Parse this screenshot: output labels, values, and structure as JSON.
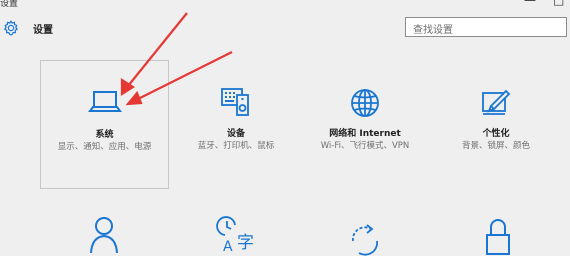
{
  "window": {
    "title": "设置",
    "minimize_glyph": "—",
    "close_glyph": "□"
  },
  "header": {
    "icon": "gear-icon",
    "title": "设置"
  },
  "search": {
    "placeholder": "查找设置"
  },
  "tiles": [
    {
      "icon": "laptop-icon",
      "label": "系统",
      "desc": "显示、通知、应用、电源"
    },
    {
      "icon": "keyboard-speaker-icon",
      "label": "设备",
      "desc": "蓝牙、打印机、鼠标"
    },
    {
      "icon": "globe-icon",
      "label": "网络和 Internet",
      "desc": "Wi-Fi、飞行模式、VPN"
    },
    {
      "icon": "paint-pen-icon",
      "label": "个性化",
      "desc": "背景、锁屏、颜色"
    },
    {
      "icon": "person-icon"
    },
    {
      "icon": "clock-language-icon",
      "glyph": "字"
    },
    {
      "icon": "update-icon"
    },
    {
      "icon": "lock-icon"
    }
  ],
  "colors": {
    "accent": "#1976d2",
    "annotation_arrow": "#e53935",
    "background": "#efefef"
  }
}
